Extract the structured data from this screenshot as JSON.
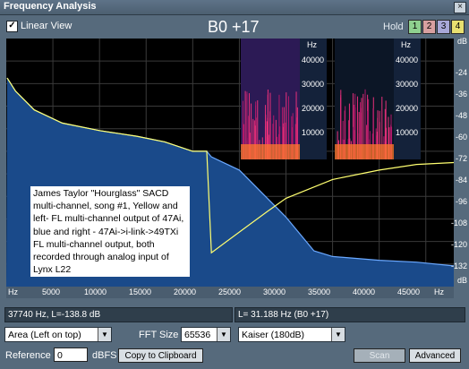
{
  "window": {
    "title": "Frequency Analysis",
    "close_glyph": "×"
  },
  "toolbar": {
    "linear_view_label": "Linear View",
    "linear_view_checked": true,
    "check_glyph": "✓",
    "display_title": "B0 +17",
    "hold_label": "Hold",
    "hold_buttons": [
      {
        "label": "1",
        "color": "#8fd08f"
      },
      {
        "label": "2",
        "color": "#d8a0a0"
      },
      {
        "label": "3",
        "color": "#a8a8d8"
      },
      {
        "label": "4",
        "color": "#e8e070"
      }
    ]
  },
  "plot": {
    "db_labels": [
      "dB",
      "-24",
      "-36",
      "-48",
      "-60",
      "-72",
      "-84",
      "-96",
      "-108",
      "-120",
      "-132",
      "dB"
    ],
    "x_labels": [
      "Hz",
      "5000",
      "10000",
      "15000",
      "20000",
      "25000",
      "30000",
      "35000",
      "40000",
      "45000",
      "Hz"
    ],
    "annotation": "James Taylor \"Hourglass\" SACD multi-channel, song #1, Yellow and left- FL multi-channel output of 47Ai, blue and right - 47Ai->i-link->49TXi FL multi-channel output, both recorded through analog input of Lynx L22",
    "spectrogram_left": {
      "hz_label": "Hz",
      "y_labels": [
        "40000",
        "30000",
        "20000",
        "10000"
      ]
    },
    "spectrogram_right": {
      "hz_label": "Hz",
      "y_labels": [
        "40000",
        "30000",
        "20000",
        "10000"
      ]
    },
    "colors": {
      "fill": "#1a4a8a",
      "blue_line": "#6aa8ff",
      "yellow_line": "#ffff70",
      "grid": "#3a3a3a"
    }
  },
  "chart_data": {
    "type": "area",
    "xlim": [
      0,
      48000
    ],
    "ylim": [
      -144,
      -12
    ],
    "xlabel": "Hz",
    "ylabel": "dB",
    "series": [
      {
        "x": [
          100,
          1000,
          3000,
          6000,
          10000,
          14000,
          17000,
          20000,
          21500,
          22000,
          25000,
          28000,
          30000,
          33000,
          35000,
          40000,
          44000,
          48000
        ],
        "values": [
          -33,
          -40,
          -50,
          -57,
          -61,
          -64,
          -67,
          -72,
          -72,
          -75,
          -82,
          -97,
          -107,
          -125,
          -128,
          -130,
          -131,
          -133
        ]
      },
      {
        "x": [
          100,
          1000,
          3000,
          6000,
          10000,
          14000,
          17000,
          20000,
          21500,
          22000,
          25000,
          28000,
          30000,
          33000,
          35000,
          40000,
          44000,
          48000
        ],
        "values": [
          -33,
          -40,
          -50,
          -57,
          -61,
          -64,
          -67,
          -72,
          -72,
          -126,
          -115,
          -104,
          -97,
          -91,
          -87,
          -82,
          -79,
          -78
        ]
      }
    ]
  },
  "status": {
    "left": "37740 Hz, L=-138.8 dB",
    "right": "L= 31.188 Hz (B0 +17)"
  },
  "controls": {
    "display_mode": "Area (Left on top)",
    "fft_label": "FFT Size",
    "fft_value": "65536",
    "window_fn": "Kaiser (180dB)",
    "dropdown_glyph": "▼",
    "reference_label": "Reference",
    "reference_value": "0",
    "dbfs_label": "dBFS",
    "copy_button": "Copy to Clipboard",
    "scan_button": "Scan",
    "advanced_button": "Advanced"
  }
}
